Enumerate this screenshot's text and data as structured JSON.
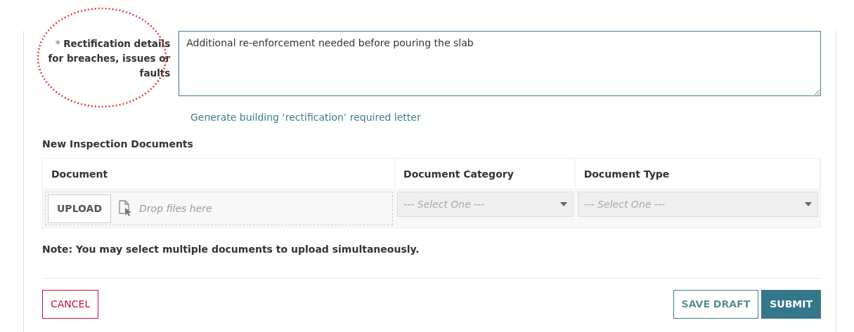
{
  "rectification": {
    "required_mark": "*",
    "label": "Rectification details for breaches, issues or faults",
    "value": "Additional re-enforcement needed before pouring the slab",
    "highlighted": true
  },
  "letter_link": "Generate building ‘rectification’ required letter",
  "documents": {
    "heading": "New Inspection Documents",
    "columns": [
      "Document",
      "Document Category",
      "Document Type"
    ],
    "upload_button": "UPLOAD",
    "drop_hint": "Drop files here",
    "selects": [
      {
        "placeholder": "--- Select One ---"
      },
      {
        "placeholder": "--- Select One ---"
      }
    ]
  },
  "note": "Note: You may select multiple documents to upload simultaneously.",
  "buttons": {
    "cancel": "CANCEL",
    "save_draft": "SAVE DRAFT",
    "submit": "SUBMIT"
  }
}
